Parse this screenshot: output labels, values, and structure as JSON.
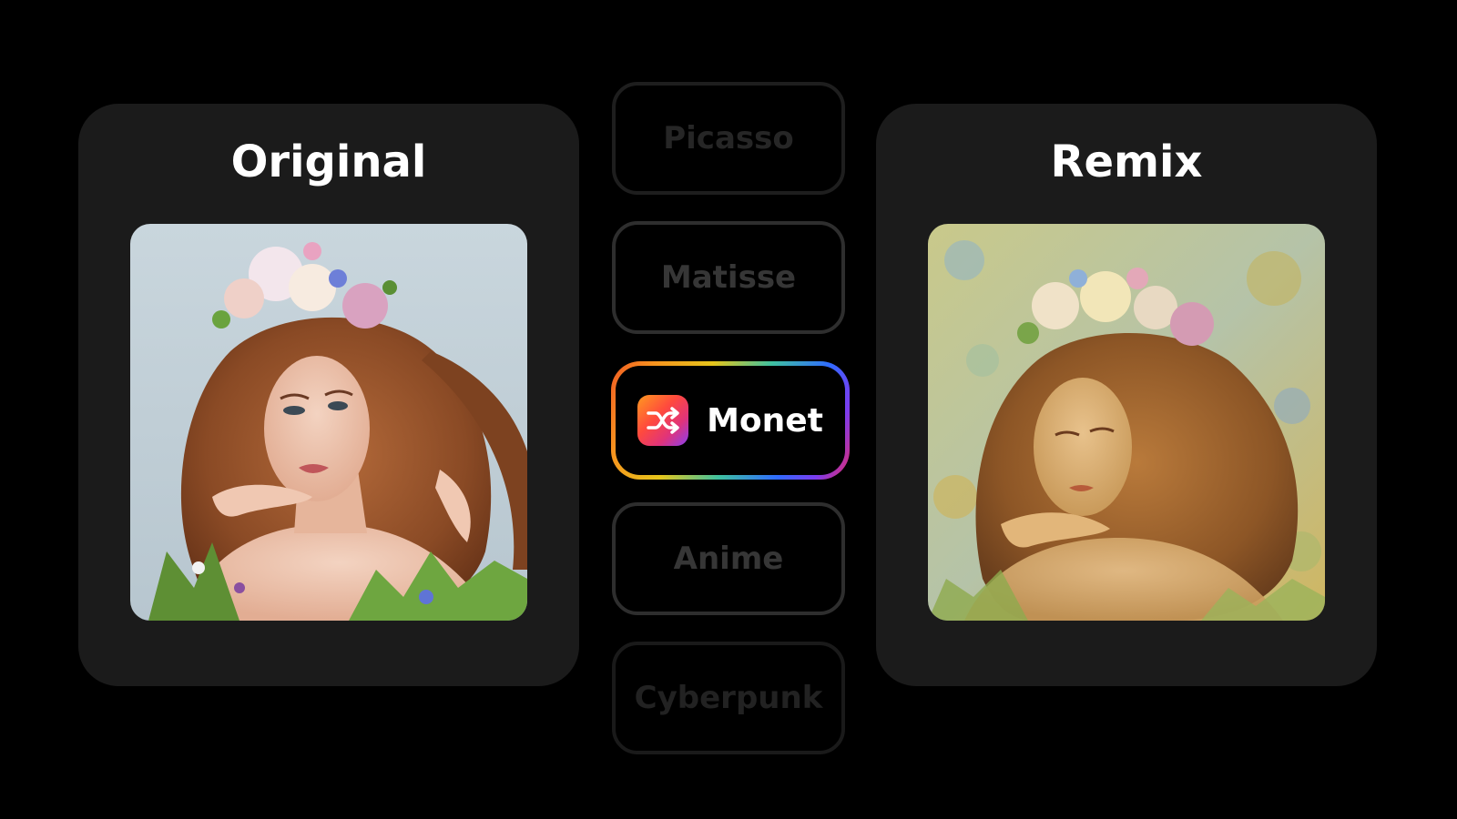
{
  "panels": {
    "original": {
      "title": "Original"
    },
    "remix": {
      "title": "Remix"
    }
  },
  "styles": [
    {
      "label": "Picasso",
      "state": "inactive"
    },
    {
      "label": "Matisse",
      "state": "inactive"
    },
    {
      "label": "Monet",
      "state": "active"
    },
    {
      "label": "Anime",
      "state": "inactive"
    },
    {
      "label": "Cyberpunk",
      "state": "inactive"
    }
  ],
  "colors": {
    "background": "#000000",
    "card": "#1b1b1b",
    "active_text": "#ffffff",
    "inactive_text": "#363636"
  },
  "icons": {
    "active_style": "shuffle-icon"
  }
}
